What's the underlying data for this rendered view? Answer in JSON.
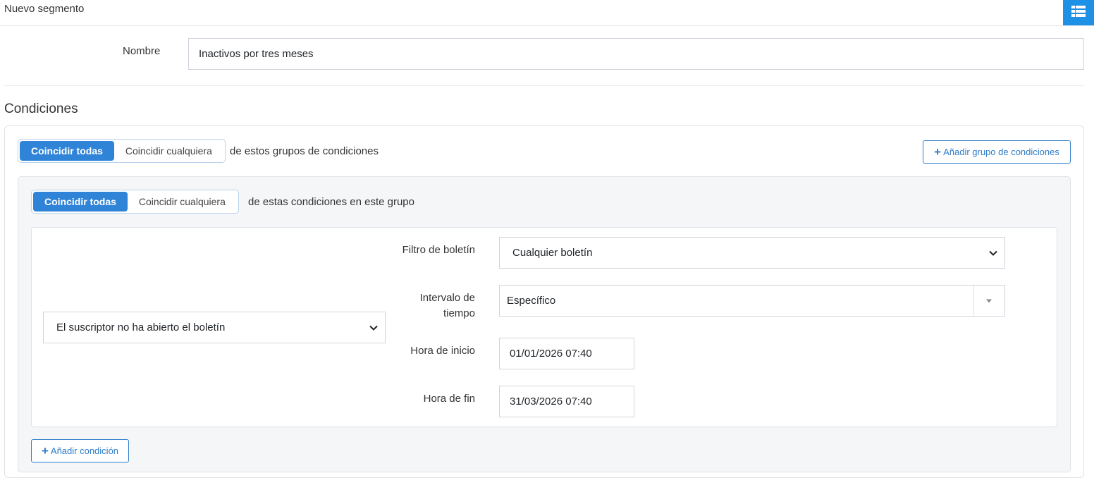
{
  "header": {
    "title": "Nuevo segmento",
    "menu_icon": "list-icon"
  },
  "form": {
    "name_label": "Nombre",
    "name_value": "Inactivos por tres meses"
  },
  "conditions": {
    "title": "Condiciones",
    "outer_toggle": {
      "match_all": "Coincidir todas",
      "match_any": "Coincidir cualquiera",
      "selected": "match_all",
      "suffix": "de estos grupos de condiciones"
    },
    "add_group_label": "Añadir grupo de condiciones",
    "group": {
      "toggle": {
        "match_all": "Coincidir todas",
        "match_any": "Coincidir cualquiera",
        "selected": "match_all",
        "suffix": "de estas condiciones en este grupo"
      },
      "condition": {
        "type_value": "El suscriptor no ha abierto el boletín",
        "newsletter_filter_label": "Filtro de boletín",
        "newsletter_filter_value": "Cualquier boletín",
        "interval_label": "Intervalo de tiempo",
        "interval_value": "Específico",
        "start_label": "Hora de inicio",
        "start_value": "01/01/2026 07:40",
        "end_label": "Hora de fin",
        "end_value": "31/03/2026 07:40"
      },
      "add_condition_label": "Añadir condición"
    }
  },
  "colors": {
    "primary": "#2f84d8",
    "menu_button": "#1e90e6",
    "outline": "#2f7cc8"
  }
}
